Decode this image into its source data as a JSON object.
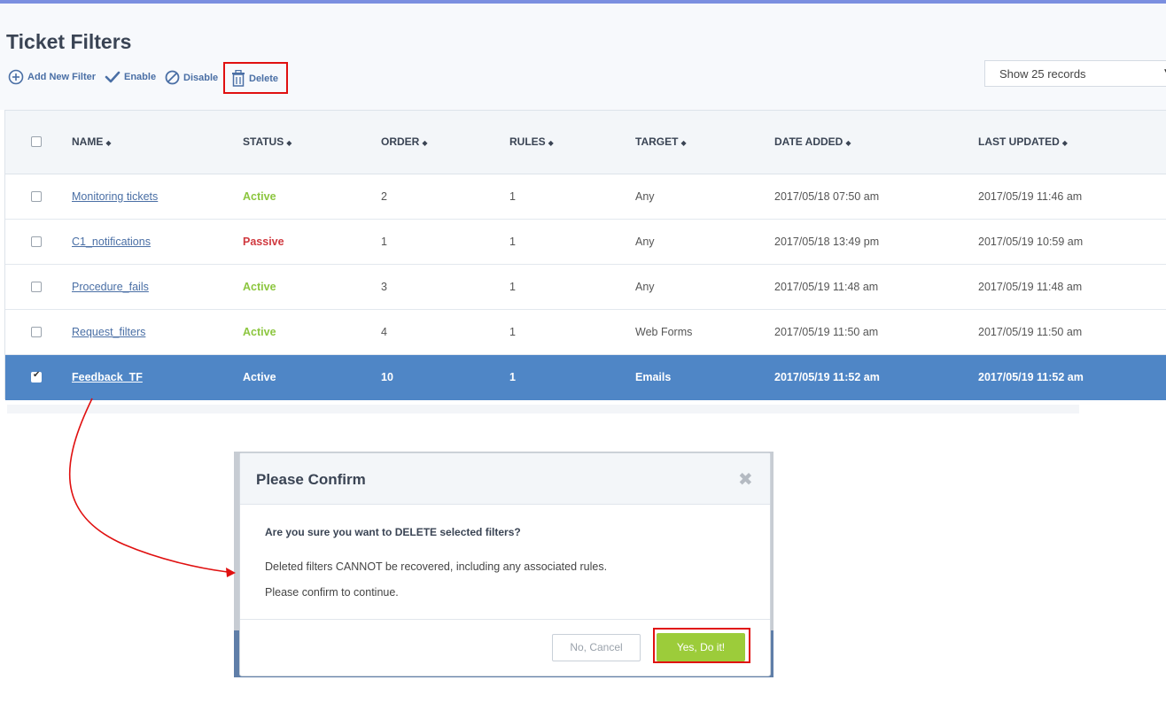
{
  "page": {
    "title": "Ticket Filters"
  },
  "toolbar": {
    "add_label": "Add New Filter",
    "enable_label": "Enable",
    "disable_label": "Disable",
    "delete_label": "Delete",
    "records_select": "Show 25 records"
  },
  "table": {
    "columns": [
      "NAME",
      "STATUS",
      "ORDER",
      "RULES",
      "TARGET",
      "DATE ADDED",
      "LAST UPDATED"
    ],
    "sort_glyph": "◆",
    "rows": [
      {
        "name": "Monitoring tickets",
        "status": "Active",
        "order": "2",
        "rules": "1",
        "target": "Any",
        "date_added": "2017/05/18 07:50 am",
        "last_updated": "2017/05/19 11:46 am",
        "checked": false
      },
      {
        "name": "C1_notifications",
        "status": "Passive",
        "order": "1",
        "rules": "1",
        "target": "Any",
        "date_added": "2017/05/18 13:49 pm",
        "last_updated": "2017/05/19 10:59 am",
        "checked": false
      },
      {
        "name": "Procedure_fails",
        "status": "Active",
        "order": "3",
        "rules": "1",
        "target": "Any",
        "date_added": "2017/05/19 11:48 am",
        "last_updated": "2017/05/19 11:48 am",
        "checked": false
      },
      {
        "name": "Request_filters",
        "status": "Active",
        "order": "4",
        "rules": "1",
        "target": "Web Forms",
        "date_added": "2017/05/19 11:50 am",
        "last_updated": "2017/05/19 11:50 am",
        "checked": false
      },
      {
        "name": "Feedback_TF",
        "status": "Active",
        "order": "10",
        "rules": "1",
        "target": "Emails",
        "date_added": "2017/05/19 11:52 am",
        "last_updated": "2017/05/19 11:52 am",
        "checked": true
      }
    ]
  },
  "modal": {
    "title": "Please Confirm",
    "question": "Are you sure you want to DELETE selected filters?",
    "line1": "Deleted filters CANNOT be recovered, including any associated rules.",
    "line2": "Please confirm to continue.",
    "cancel_label": "No, Cancel",
    "confirm_label": "Yes, Do it!",
    "close_glyph": "✖"
  },
  "colors": {
    "accent": "#4a6fa5",
    "selected_row": "#4f86c6",
    "active": "#8cc63f",
    "passive": "#d0393f",
    "confirm": "#9ccc3a",
    "highlight": "#e01010"
  }
}
